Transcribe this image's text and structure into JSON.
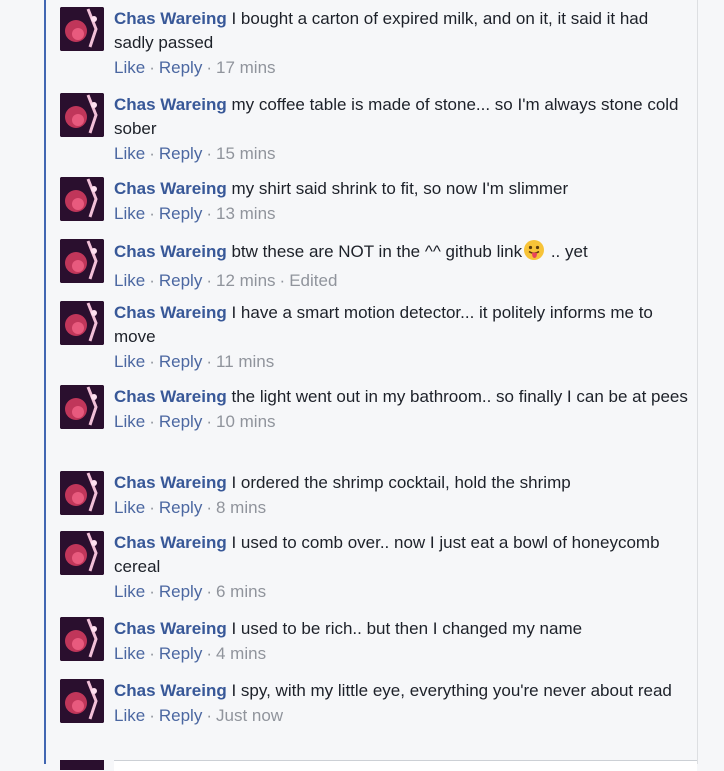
{
  "comments": [
    {
      "author": "Chas Wareing",
      "text": "I bought a carton of expired milk, and on it, it said it had sadly passed",
      "like": "Like",
      "reply": "Reply",
      "time": "17 mins"
    },
    {
      "author": "Chas Wareing",
      "text": "my coffee table is made of stone... so I'm always stone cold sober",
      "like": "Like",
      "reply": "Reply",
      "time": "15 mins"
    },
    {
      "author": "Chas Wareing",
      "text": "my shirt said shrink to fit, so now I'm slimmer",
      "like": "Like",
      "reply": "Reply",
      "time": "13 mins"
    },
    {
      "author": "Chas Wareing",
      "text": "btw these are NOT in the ^^ github link",
      "text_after": " .. yet",
      "emoji": "tongue-out-emoji",
      "like": "Like",
      "reply": "Reply",
      "time": "12 mins",
      "edited": "Edited"
    },
    {
      "author": "Chas Wareing",
      "text": "I have a smart motion detector... it politely informs me to move",
      "like": "Like",
      "reply": "Reply",
      "time": "11 mins"
    },
    {
      "author": "Chas Wareing",
      "text": "the light went out in my bathroom.. so finally I can be at pees",
      "like": "Like",
      "reply": "Reply",
      "time": "10 mins"
    },
    {
      "author": "Chas Wareing",
      "text": "I ordered the shrimp cocktail, hold the shrimp",
      "like": "Like",
      "reply": "Reply",
      "time": "8 mins"
    },
    {
      "author": "Chas Wareing",
      "text": "I used to comb over.. now I just eat a bowl of honeycomb cereal",
      "like": "Like",
      "reply": "Reply",
      "time": "6 mins"
    },
    {
      "author": "Chas Wareing",
      "text": "I used to be rich.. but then I changed my name",
      "like": "Like",
      "reply": "Reply",
      "time": "4 mins"
    },
    {
      "author": "Chas Wareing",
      "text": "I spy, with my little eye, everything you're never about read",
      "like": "Like",
      "reply": "Reply",
      "time": "Just now"
    }
  ],
  "separator": "·",
  "colors": {
    "author": "#385898",
    "link": "#4b67a1",
    "meta": "#90949c",
    "text": "#1d2129",
    "thread_line": "#4267b2",
    "background": "#f6f7f9"
  }
}
